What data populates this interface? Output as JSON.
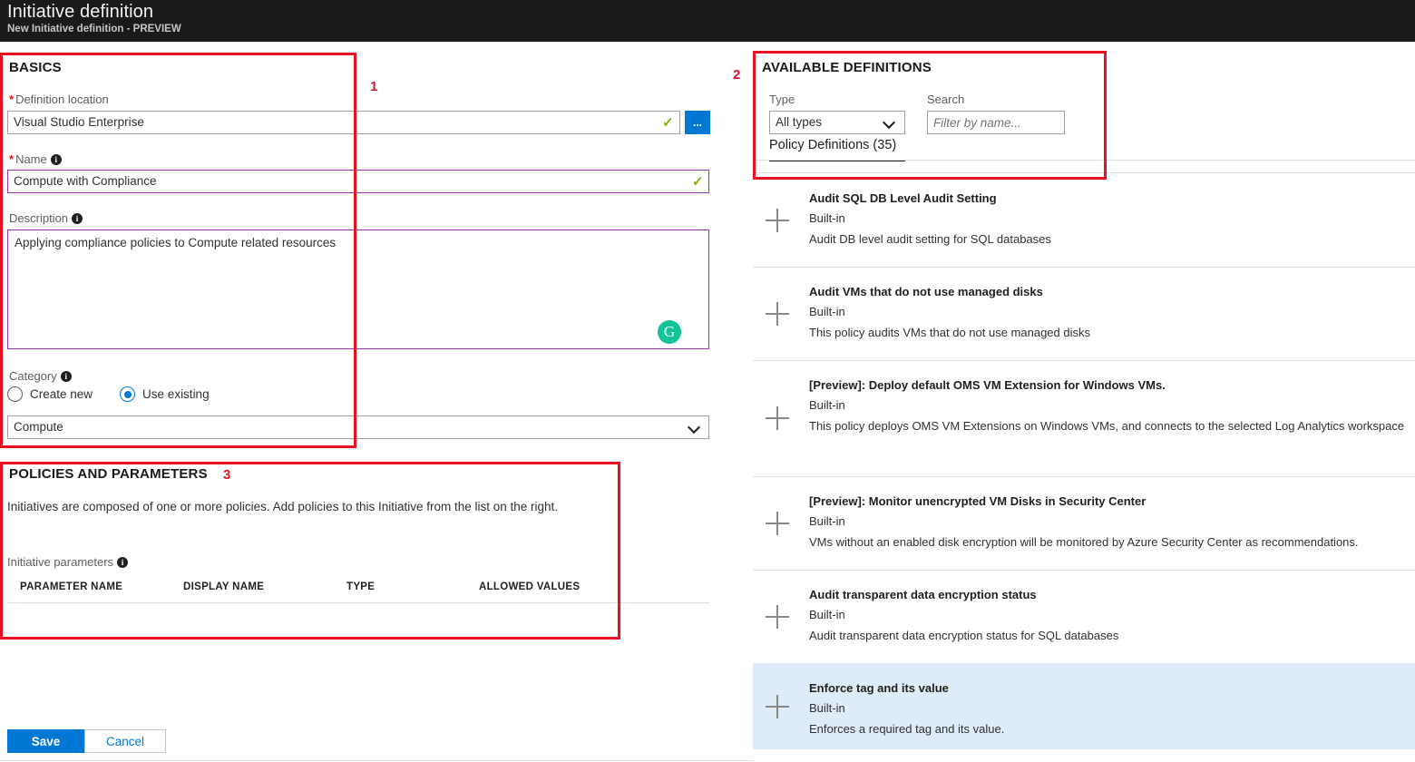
{
  "header": {
    "title": "Initiative definition",
    "subtitle": "New Initiative definition - PREVIEW"
  },
  "annotations": {
    "one": "1",
    "two": "2",
    "three": "3"
  },
  "basics": {
    "section_title": "BASICS",
    "definition_location": {
      "label": "Definition location",
      "required_marker": "*",
      "value": "Visual Studio Enterprise",
      "valid_icon": "✓",
      "browse_button_label": "...",
      "browse_icon_name": "ellipsis-icon"
    },
    "name": {
      "label": "Name",
      "required_marker": "*",
      "value": "Compute with Compliance",
      "valid_icon": "✓",
      "info_icon": "i"
    },
    "description": {
      "label": "Description",
      "value": "Applying compliance policies to Compute related resources",
      "info_icon": "i",
      "grammarly_glyph": "G"
    },
    "category": {
      "label": "Category",
      "info_icon": "i",
      "option_create_new": "Create new",
      "option_use_existing": "Use existing",
      "selected_option": "Use existing",
      "value": "Compute"
    }
  },
  "policies_and_parameters": {
    "section_title": "POLICIES AND PARAMETERS",
    "intro": "Initiatives are composed of one or more policies. Add policies to this Initiative from the list on the right.",
    "parameters_label": "Initiative parameters",
    "info_icon": "i",
    "columns": [
      "PARAMETER NAME",
      "DISPLAY NAME",
      "TYPE",
      "ALLOWED VALUES"
    ],
    "rows": []
  },
  "available_definitions": {
    "section_title": "AVAILABLE DEFINITIONS",
    "type_label": "Type",
    "type_value": "All types",
    "search_label": "Search",
    "search_placeholder": "Filter by name...",
    "search_value": "",
    "tab_label": "Policy Definitions (35)",
    "items": [
      {
        "title": "Audit SQL DB Level Audit Setting",
        "origin": "Built-in",
        "description": "Audit DB level audit setting for SQL databases",
        "selected": false
      },
      {
        "title": "Audit VMs that do not use managed disks",
        "origin": "Built-in",
        "description": "This policy audits VMs that do not use managed disks",
        "selected": false
      },
      {
        "title": "[Preview]: Deploy default OMS VM Extension for Windows VMs.",
        "origin": "Built-in",
        "description": "This policy deploys OMS VM Extensions on Windows VMs, and connects to the selected Log Analytics workspace",
        "selected": false
      },
      {
        "title": "[Preview]: Monitor unencrypted VM Disks in Security Center",
        "origin": "Built-in",
        "description": "VMs without an enabled disk encryption will be monitored by Azure Security Center as recommendations.",
        "selected": false
      },
      {
        "title": "Audit transparent data encryption status",
        "origin": "Built-in",
        "description": "Audit transparent data encryption status for SQL databases",
        "selected": false
      },
      {
        "title": "Enforce tag and its value",
        "origin": "Built-in",
        "description": "Enforces a required tag and its value.",
        "selected": true
      }
    ]
  },
  "footer": {
    "save_label": "Save",
    "cancel_label": "Cancel"
  },
  "colors": {
    "accent": "#0078d4",
    "annotation": "#e81123",
    "valid": "#7fba00",
    "focus_border": "#9b30b0",
    "selected_row": "#deecf9",
    "header_bg": "#1b1a19",
    "grammarly": "#15c39a"
  }
}
